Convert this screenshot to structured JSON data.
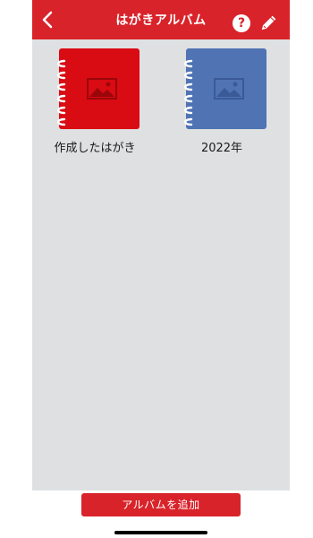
{
  "header": {
    "title": "はがきアルバム",
    "help_symbol": "?",
    "back_icon": "chevron-left-icon",
    "edit_icon": "pencil-icon"
  },
  "albums": [
    {
      "label": "作成したはがき",
      "color": "#d90b13",
      "icon": "image-icon"
    },
    {
      "label": "2022年",
      "color": "#4f73b3",
      "icon": "image-icon"
    }
  ],
  "footer": {
    "add_button_label": "アルバムを追加"
  },
  "colors": {
    "brand": "#d9232a",
    "background": "#dfe0e2"
  }
}
